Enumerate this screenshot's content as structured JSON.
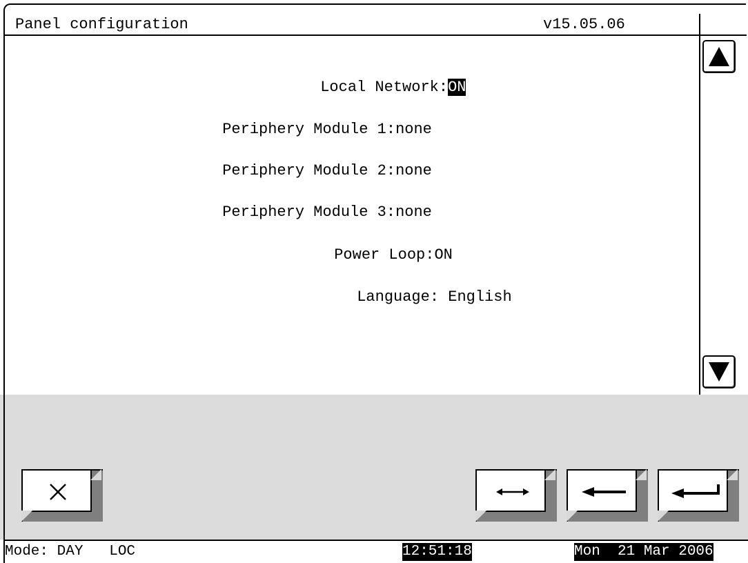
{
  "header": {
    "title": "Panel configuration",
    "version": "v15.05.06"
  },
  "settings": [
    {
      "label": "Local Network:",
      "value": "ON",
      "selected": true
    },
    {
      "label": "Periphery Module 1:",
      "value": "none",
      "selected": false
    },
    {
      "label": "Periphery Module 2:",
      "value": "none",
      "selected": false
    },
    {
      "label": "Periphery Module 3:",
      "value": "none",
      "selected": false
    },
    {
      "label": "Power Loop:",
      "value": "ON",
      "selected": false
    },
    {
      "label": "Language:",
      "value": " English",
      "selected": false
    }
  ],
  "scroll": {
    "up_icon": "triangle-up-icon",
    "down_icon": "triangle-down-icon"
  },
  "keys": {
    "cancel_icon": "close-x-icon",
    "toggle_icon": "double-arrow-icon",
    "back_icon": "left-arrow-icon",
    "enter_icon": "enter-return-icon"
  },
  "status": {
    "mode": "Mode: DAY   LOC",
    "time": "12:51:18",
    "date": "Mon  21 Mar 2006"
  },
  "colors": {
    "highlight_bg": "#000000",
    "highlight_fg": "#ffffff",
    "panel_bg": "#dcdcdc"
  }
}
